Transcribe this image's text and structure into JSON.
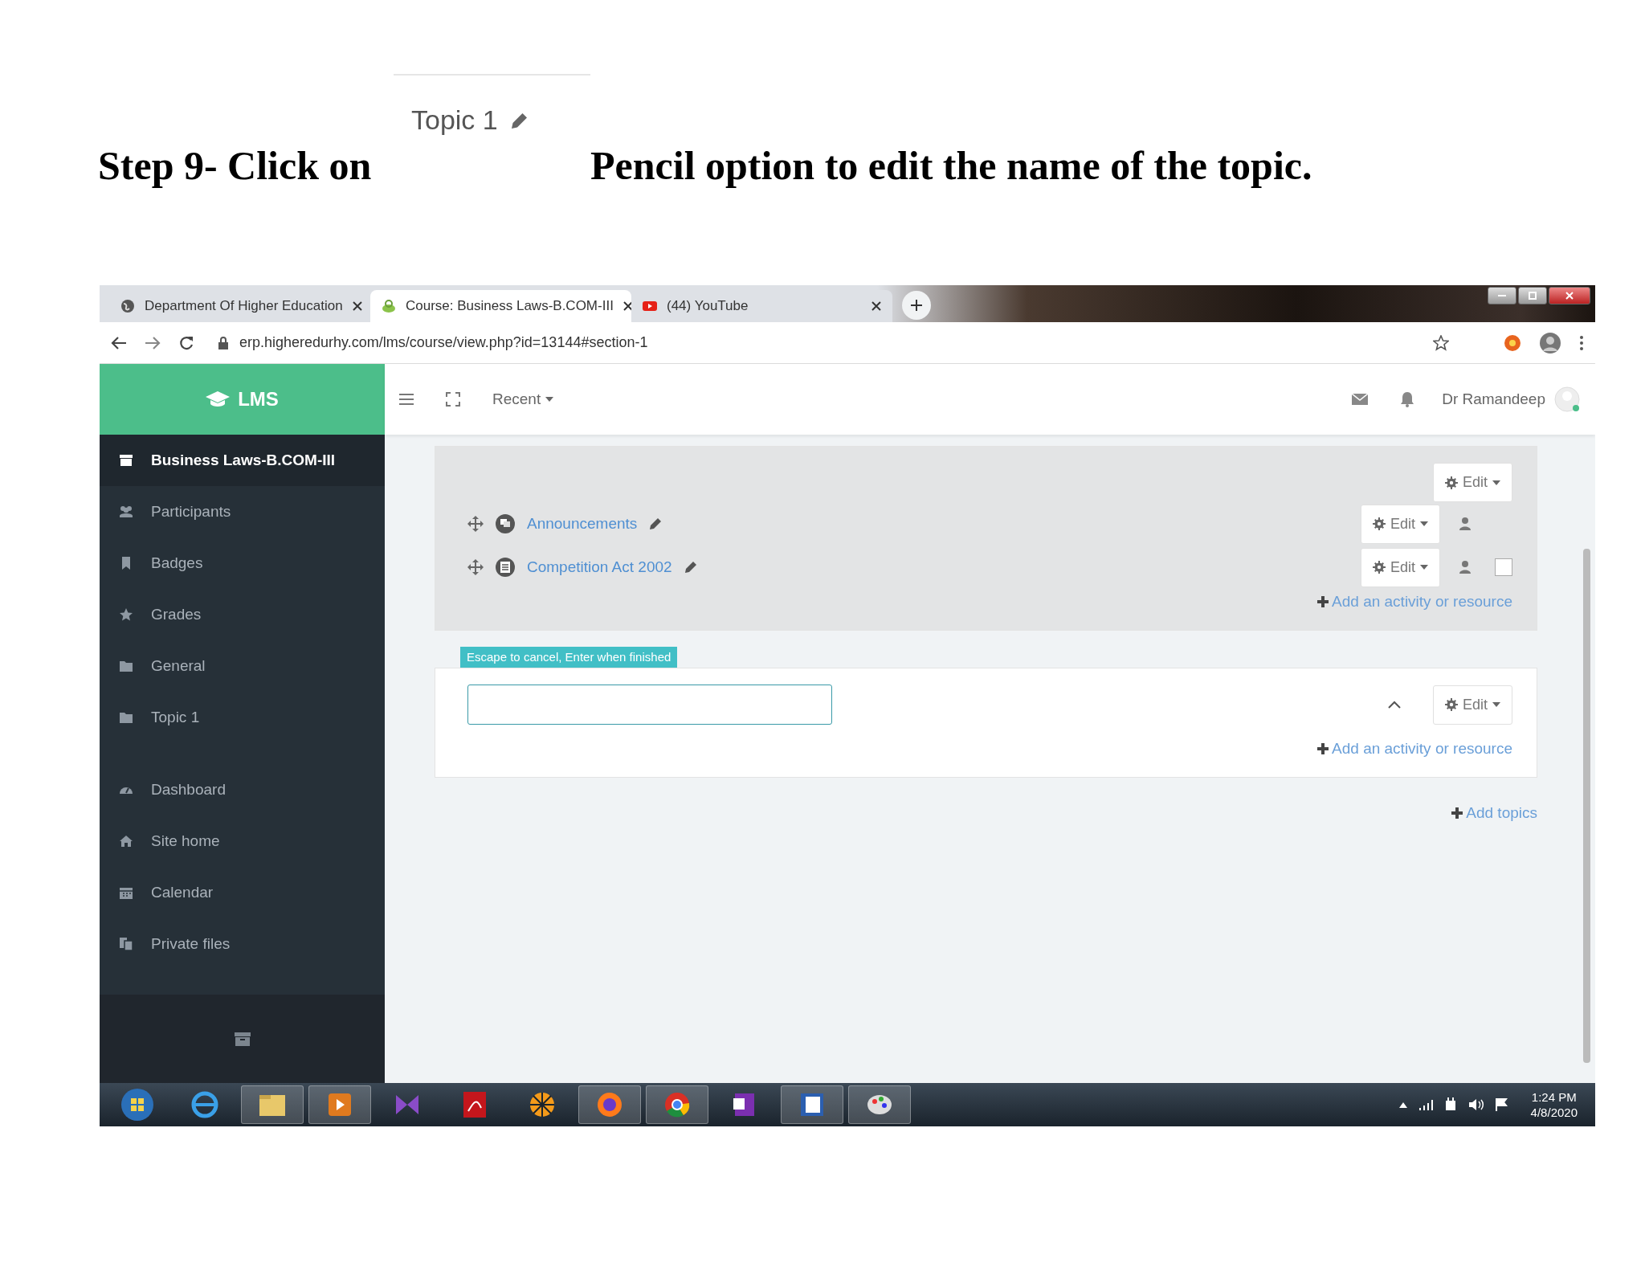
{
  "document": {
    "snippet_title": "Topic 1",
    "instruction_left": "Step 9- Click on",
    "instruction_right": "Pencil option to edit the name of the topic."
  },
  "browser": {
    "tabs": [
      {
        "title": "Department Of Higher Education",
        "kind": "globe",
        "selected": false
      },
      {
        "title": "Course: Business Laws-B.COM-III",
        "kind": "moodle",
        "selected": true
      },
      {
        "title": "(44) YouTube",
        "kind": "youtube",
        "selected": false
      }
    ],
    "url": "erp.higheredurhy.com/lms/course/view.php?id=13144#section-1"
  },
  "header": {
    "brand": "LMS",
    "recent": "Recent",
    "user": "Dr Ramandeep"
  },
  "sidebar": {
    "course_items": [
      {
        "label": "Business Laws-B.COM-III",
        "kind": "course",
        "selected": true
      },
      {
        "label": "Participants",
        "kind": "users",
        "selected": false
      },
      {
        "label": "Badges",
        "kind": "bookmark",
        "selected": false
      },
      {
        "label": "Grades",
        "kind": "star",
        "selected": false
      },
      {
        "label": "General",
        "kind": "folder",
        "selected": false
      },
      {
        "label": "Topic 1",
        "kind": "folder",
        "selected": false
      }
    ],
    "site_items": [
      {
        "label": "Dashboard",
        "kind": "gauge",
        "selected": false
      },
      {
        "label": "Site home",
        "kind": "home",
        "selected": false
      },
      {
        "label": "Calendar",
        "kind": "calendar",
        "selected": false
      },
      {
        "label": "Private files",
        "kind": "files",
        "selected": false
      }
    ]
  },
  "sections": [
    {
      "highlighted": true,
      "edit": "Edit",
      "activities": [
        {
          "name": "Announcements",
          "kind": "forum",
          "edit": "Edit"
        },
        {
          "name": "Competition Act 2002",
          "kind": "page",
          "edit": "Edit",
          "checked": false
        }
      ],
      "add_link": "Add an activity or resource"
    },
    {
      "highlighted": false,
      "editing_name": true,
      "tooltip": "Escape to cancel, Enter when finished",
      "edit": "Edit",
      "add_link": "Add an activity or resource"
    }
  ],
  "add_topics": "Add topics",
  "taskbar": {
    "time": "1:24 PM",
    "date": "4/8/2020"
  }
}
